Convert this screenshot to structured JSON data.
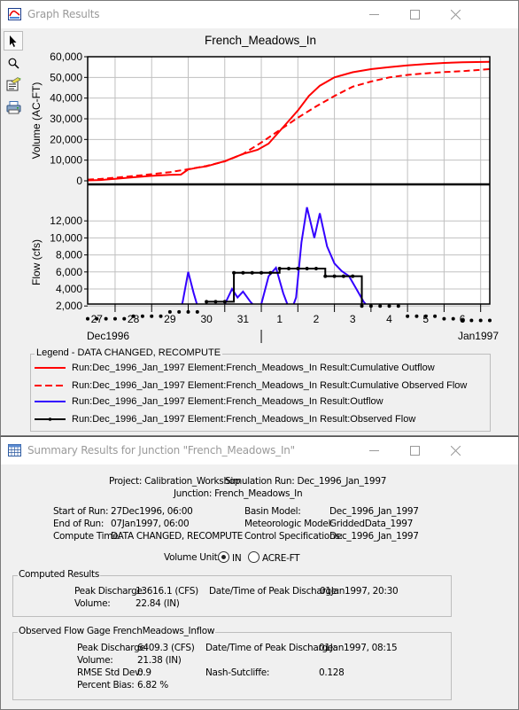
{
  "graph_window": {
    "title": "Graph Results",
    "icon": "graph-chart-icon",
    "controls": [
      "minimize",
      "maximize",
      "close"
    ],
    "toolbar": [
      {
        "name": "select-pointer",
        "icon": "pointer-arrow-icon",
        "selected": true
      },
      {
        "name": "zoom",
        "icon": "magnifier-icon",
        "selected": false
      },
      {
        "name": "edit-properties",
        "icon": "edit-document-icon",
        "selected": false
      },
      {
        "name": "print",
        "icon": "printer-icon",
        "selected": false
      }
    ]
  },
  "chart_data": [
    {
      "type": "line",
      "title": "French_Meadows_In",
      "ylabel": "Volume (AC-FT)",
      "xlabel": "",
      "ylim": [
        0,
        60000
      ],
      "yticks": [
        0,
        10000,
        20000,
        30000,
        40000,
        50000,
        60000
      ],
      "ytick_labels": [
        "0",
        "10,000",
        "20,000",
        "30,000",
        "40,000",
        "50,000",
        "60,000"
      ],
      "grid": true,
      "x_unit": "days since 27Dec1996 00:00",
      "xlim": [
        0.25,
        11.25
      ],
      "series": [
        {
          "name": "Cumulative Outflow",
          "color": "#ff0000",
          "style": "solid",
          "x": [
            0.25,
            0.6,
            1,
            1.5,
            2,
            2.5,
            2.8,
            3.0,
            3.3,
            3.5,
            4,
            4.5,
            4.9,
            5.2,
            5.5,
            5.8,
            6.0,
            6.3,
            6.6,
            7.0,
            7.5,
            8,
            8.5,
            9,
            9.5,
            10,
            10.5,
            11.25
          ],
          "y": [
            200,
            400,
            1000,
            1700,
            2400,
            2900,
            3000,
            5500,
            6500,
            7000,
            9500,
            13000,
            15000,
            18000,
            24000,
            30000,
            34000,
            41000,
            46000,
            50000,
            52500,
            54000,
            55000,
            55800,
            56500,
            57000,
            57300,
            57500
          ]
        },
        {
          "name": "Cumulative Observed Flow",
          "color": "#ff0000",
          "style": "dashed",
          "x": [
            0.25,
            0.6,
            1,
            1.5,
            2,
            2.5,
            3,
            3.5,
            4,
            4.5,
            5,
            5.5,
            6,
            6.5,
            7,
            7.5,
            8,
            8.5,
            9,
            9.5,
            10,
            10.5,
            11.25
          ],
          "y": [
            600,
            900,
            1500,
            2300,
            3200,
            4200,
            5600,
            7200,
            9400,
            13000,
            18500,
            24500,
            30500,
            36000,
            41000,
            45500,
            48000,
            50000,
            51200,
            52000,
            52600,
            53000,
            54000
          ]
        }
      ]
    },
    {
      "type": "line",
      "title": "",
      "ylabel": "Flow (cfs)",
      "xlabel": "",
      "ylim": [
        0,
        14000
      ],
      "yticks": [
        2000,
        4000,
        6000,
        8000,
        10000,
        12000
      ],
      "ytick_labels": [
        "2,000",
        "4,000",
        "6,000",
        "8,000",
        "10,000",
        "12,000"
      ],
      "grid": true,
      "x_unit": "days since 27Dec1996 00:00",
      "xlim": [
        0.25,
        11.25
      ],
      "xtick_positions": [
        1,
        2,
        3,
        4,
        5,
        6,
        7,
        8,
        9,
        10,
        11
      ],
      "xday_labels": [
        "27",
        "28",
        "29",
        "30",
        "31",
        "1",
        "2",
        "3",
        "4",
        "5",
        "6"
      ],
      "xday_label_centers": [
        0.5,
        1.5,
        2.5,
        3.5,
        4.5,
        5.5,
        6.5,
        7.5,
        8.5,
        9.5,
        10.5
      ],
      "month_labels": [
        {
          "label": "Dec1996",
          "anchor": "left"
        },
        {
          "label": "Jan1997",
          "anchor": "right"
        }
      ],
      "month_divider": 5,
      "series": [
        {
          "name": "Outflow",
          "color": "#3300ff",
          "style": "solid",
          "x": [
            0.25,
            0.5,
            1,
            1.3,
            1.6,
            2,
            2.4,
            2.7,
            2.85,
            3.0,
            3.15,
            3.3,
            3.5,
            3.8,
            4.0,
            4.2,
            4.35,
            4.5,
            4.7,
            4.85,
            5.0,
            5.2,
            5.4,
            5.6,
            5.8,
            5.95,
            6.1,
            6.25,
            6.45,
            6.6,
            6.8,
            7.0,
            7.2,
            7.4,
            7.6,
            7.8,
            8.0,
            8.3,
            8.7,
            9.0,
            9.5,
            10,
            10.5,
            11.25
          ],
          "y": [
            600,
            550,
            500,
            350,
            300,
            250,
            200,
            150,
            2500,
            6000,
            3500,
            1300,
            1000,
            1200,
            2200,
            4000,
            3000,
            3700,
            2500,
            1800,
            2200,
            5500,
            6500,
            3500,
            1200,
            3000,
            9500,
            13600,
            10000,
            12900,
            9000,
            7000,
            6100,
            5500,
            4000,
            2500,
            1500,
            1000,
            700,
            500,
            400,
            300,
            250,
            200
          ]
        },
        {
          "name": "Observed Flow",
          "color": "#000000",
          "style": "step-with-markers",
          "x": [
            0.25,
            0.5,
            0.75,
            1,
            1.25,
            1.5,
            1.75,
            2,
            2.25,
            2.5,
            2.75,
            3,
            3.25,
            3.5,
            3.75,
            4,
            4.25,
            4.5,
            4.75,
            5,
            5.25,
            5.5,
            5.75,
            6,
            6.25,
            6.5,
            6.75,
            7,
            7.25,
            7.5,
            7.75,
            8,
            8.25,
            8.5,
            8.75,
            9,
            9.25,
            9.5,
            9.75,
            10,
            10.25,
            10.5,
            10.75,
            11,
            11.25
          ],
          "y": [
            500,
            500,
            500,
            500,
            500,
            800,
            800,
            800,
            800,
            1300,
            1300,
            1300,
            1300,
            2500,
            2500,
            2500,
            5900,
            5900,
            5900,
            5900,
            5900,
            6400,
            6400,
            6400,
            6400,
            6400,
            5500,
            5500,
            5500,
            5500,
            2000,
            2000,
            2000,
            2000,
            2000,
            800,
            800,
            800,
            800,
            500,
            500,
            300,
            300,
            300,
            300
          ]
        }
      ]
    }
  ],
  "legend": {
    "title": "Legend - DATA CHANGED, RECOMPUTE",
    "items": [
      {
        "label": "Run:Dec_1996_Jan_1997 Element:French_Meadows_In Result:Cumulative Outflow",
        "color": "#ff0000",
        "style": "solid"
      },
      {
        "label": "Run:Dec_1996_Jan_1997 Element:French_Meadows_In Result:Cumulative Observed Flow",
        "color": "#ff0000",
        "style": "dashed"
      },
      {
        "label": "Run:Dec_1996_Jan_1997 Element:French_Meadows_In Result:Outflow",
        "color": "#3300ff",
        "style": "solid"
      },
      {
        "label": "Run:Dec_1996_Jan_1997 Element:French_Meadows_In Result:Observed Flow",
        "color": "#000000",
        "style": "marker"
      }
    ]
  },
  "summary_window": {
    "title": "Summary Results for Junction \"French_Meadows_In\"",
    "icon": "table-grid-icon",
    "header": {
      "project": "Project: Calibration_Workshop",
      "simulation_run": "Simulation Run: Dec_1996_Jan_1997",
      "junction": "Junction: French_Meadows_In"
    },
    "info": {
      "start_label": "Start of Run:",
      "start_value": "27Dec1996, 06:00",
      "end_label": "End of Run:",
      "end_value": "07Jan1997, 06:00",
      "compute_label": "Compute Time:",
      "compute_value": "DATA CHANGED, RECOMPUTE",
      "basin_label": "Basin Model:",
      "basin_value": "Dec_1996_Jan_1997",
      "met_label": "Meteorologic Model:",
      "met_value": "GriddedData_1997",
      "control_label": "Control Specifications:",
      "control_value": "Dec_1996_Jan_1997"
    },
    "volume_units": {
      "label": "Volume Units:",
      "options": [
        {
          "label": "IN",
          "selected": true
        },
        {
          "label": "ACRE-FT",
          "selected": false
        }
      ]
    },
    "computed": {
      "title": "Computed Results",
      "peak_label": "Peak Discharge:",
      "peak_value": "13616.1 (CFS)",
      "peak_time_label": "Date/Time of Peak Discharge:",
      "peak_time_value": "01Jan1997, 20:30",
      "volume_label": "Volume:",
      "volume_value": "22.84 (IN)"
    },
    "observed": {
      "title": "Observed Flow Gage FrenchMeadows_Inflow",
      "peak_label": "Peak Discharge:",
      "peak_value": "6409.3 (CFS)",
      "peak_time_label": "Date/Time of Peak Discharge:",
      "peak_time_value": "01Jan1997, 08:15",
      "volume_label": "Volume:",
      "volume_value": "21.38 (IN)",
      "rmse_label": "RMSE Std Dev:",
      "rmse_value": "0.9",
      "nash_label": "Nash-Sutcliffe:",
      "nash_value": "0.128",
      "bias_label": "Percent Bias:",
      "bias_value": "6.82 %"
    }
  }
}
